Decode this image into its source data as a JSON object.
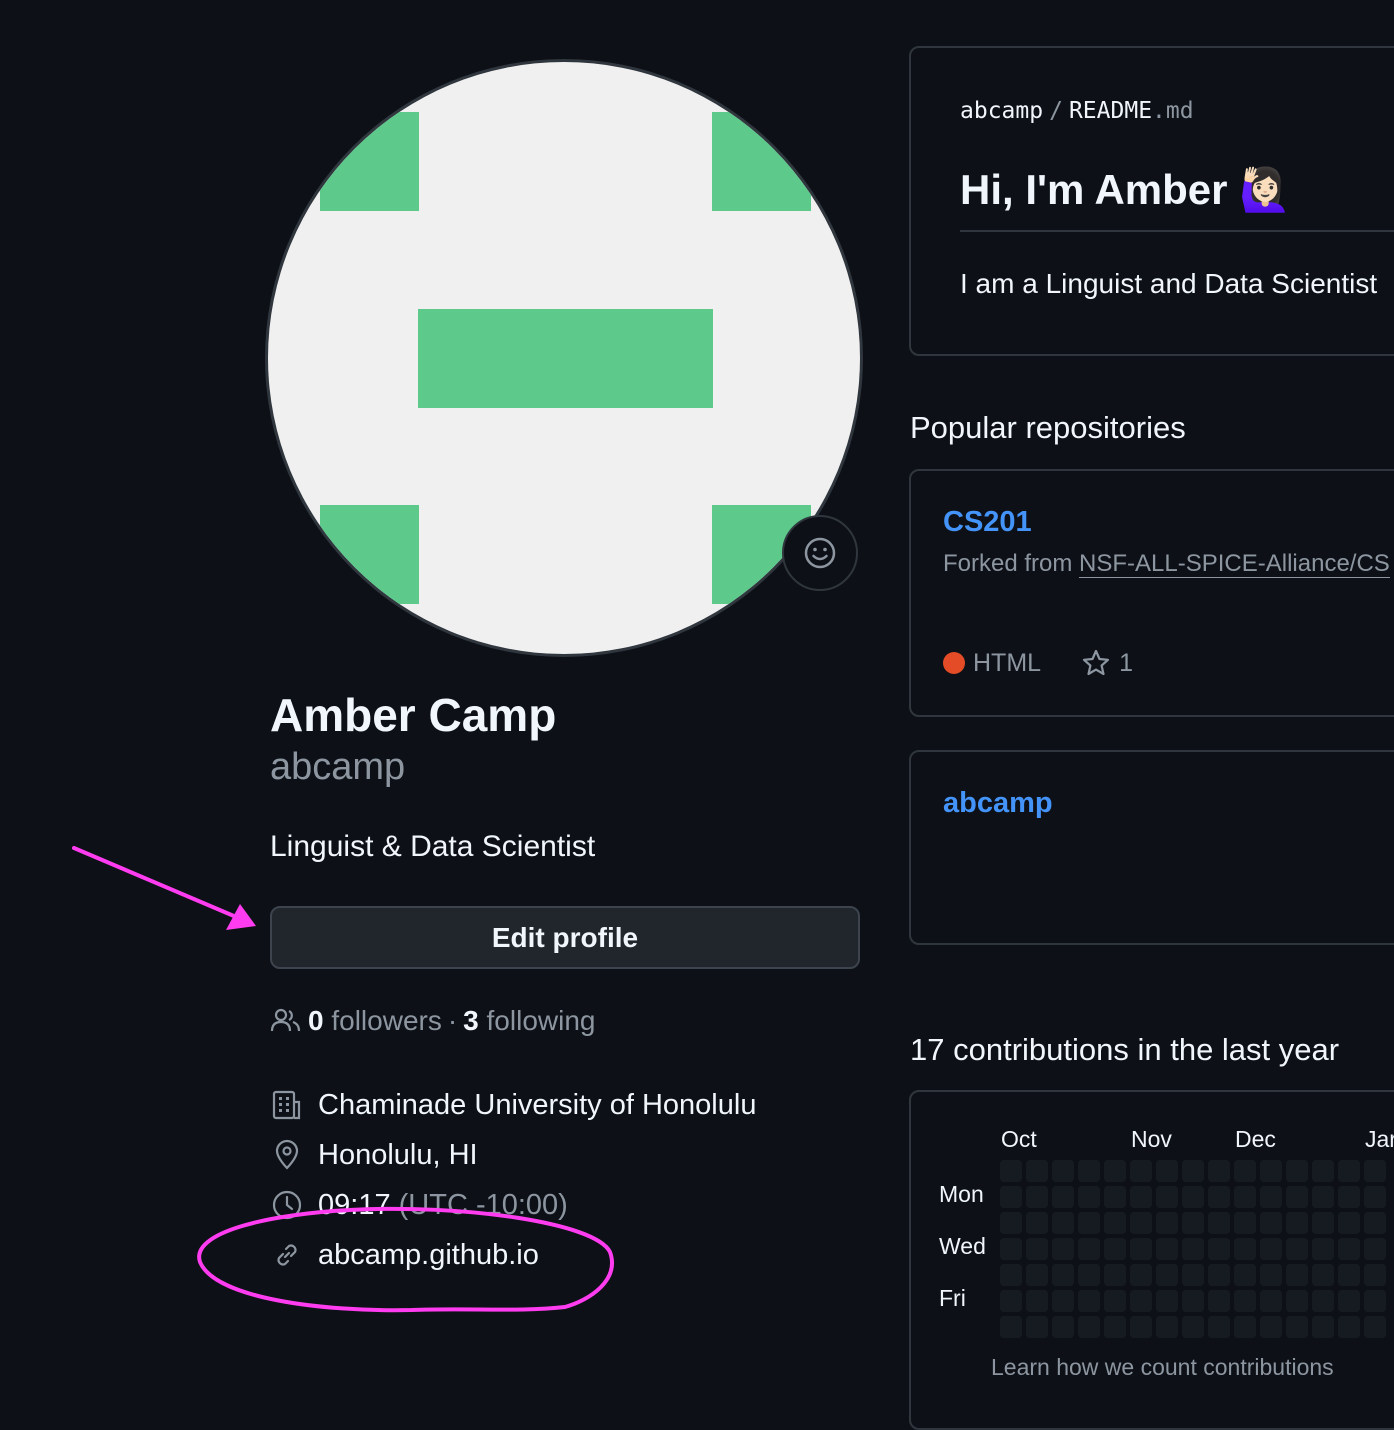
{
  "profile": {
    "full_name": "Amber Camp",
    "username": "abcamp",
    "bio": "Linguist & Data Scientist",
    "edit_button": "Edit profile",
    "followers_count": "0",
    "followers_label": "followers",
    "separator": "·",
    "following_count": "3",
    "following_label": "following",
    "organization": "Chaminade University of Honolulu",
    "location": "Honolulu, HI",
    "local_time": "09:17",
    "timezone": "(UTC -10:00)",
    "website": "abcamp.github.io"
  },
  "readme": {
    "owner": "abcamp",
    "slash": "/",
    "file_name": "README",
    "file_ext": ".md",
    "heading": "Hi, I'm Amber",
    "heading_emoji": "🙋🏻‍♀️",
    "text": "I am a Linguist and Data Scientist"
  },
  "popular": {
    "heading": "Popular repositories",
    "repos": [
      {
        "name": "CS201",
        "forked_prefix": "Forked from",
        "forked_from": "NSF-ALL-SPICE-Alliance/CS",
        "language": "HTML",
        "language_color": "#e34c26",
        "stars": "1"
      },
      {
        "name": "abcamp"
      }
    ]
  },
  "contributions": {
    "heading": "17 contributions in the last year",
    "months": [
      "Oct",
      "Nov",
      "Dec",
      "Jar"
    ],
    "days": [
      "Mon",
      "Wed",
      "Fri"
    ],
    "learn_link": "Learn how we count contributions"
  },
  "colors": {
    "background": "#0d1117",
    "link": "#4493f8",
    "annotation": "#ff3cf0",
    "avatar_green": "#5dc98b"
  }
}
